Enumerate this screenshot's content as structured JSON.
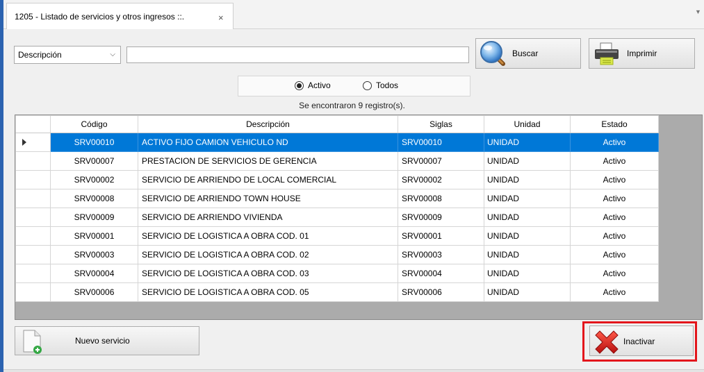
{
  "tab": {
    "title": "1205 - Listado de servicios y otros ingresos ::.",
    "close_glyph": "×",
    "menu_glyph": "▼"
  },
  "filter": {
    "field": "Descripción",
    "search_value": "",
    "chevron_glyph": "⌵"
  },
  "buttons": {
    "search": "Buscar",
    "print": "Imprimir",
    "new_service": "Nuevo servicio",
    "deactivate": "Inactivar"
  },
  "status_filter": {
    "active": "Activo",
    "all": "Todos",
    "selected": "active"
  },
  "result_text": "Se encontraron 9 registro(s).",
  "table": {
    "columns": [
      "Código",
      "Descripción",
      "Siglas",
      "Unidad",
      "Estado"
    ],
    "rows": [
      [
        "SRV00010",
        "ACTIVO FIJO CAMION VEHICULO ND",
        "SRV00010",
        "UNIDAD",
        "Activo"
      ],
      [
        "SRV00007",
        "PRESTACION DE SERVICIOS DE GERENCIA",
        "SRV00007",
        "UNIDAD",
        "Activo"
      ],
      [
        "SRV00002",
        "SERVICIO DE ARRIENDO DE LOCAL COMERCIAL",
        "SRV00002",
        "UNIDAD",
        "Activo"
      ],
      [
        "SRV00008",
        "SERVICIO DE ARRIENDO TOWN HOUSE",
        "SRV00008",
        "UNIDAD",
        "Activo"
      ],
      [
        "SRV00009",
        "SERVICIO DE ARRIENDO VIVIENDA",
        "SRV00009",
        "UNIDAD",
        "Activo"
      ],
      [
        "SRV00001",
        "SERVICIO DE LOGISTICA A OBRA COD. 01",
        "SRV00001",
        "UNIDAD",
        "Activo"
      ],
      [
        "SRV00003",
        "SERVICIO DE LOGISTICA A OBRA COD. 02",
        "SRV00003",
        "UNIDAD",
        "Activo"
      ],
      [
        "SRV00004",
        "SERVICIO DE LOGISTICA A OBRA COD. 03",
        "SRV00004",
        "UNIDAD",
        "Activo"
      ],
      [
        "SRV00006",
        "SERVICIO DE LOGISTICA A OBRA COD. 05",
        "SRV00006",
        "UNIDAD",
        "Activo"
      ]
    ],
    "selected_row": 0
  },
  "icons": {
    "search": "magnifier-icon",
    "print": "printer-icon",
    "new_service": "new-document-icon",
    "deactivate": "red-x-icon"
  },
  "colors": {
    "selection": "#0078d7",
    "highlight": "#e3161c",
    "window_accent": "#2c63b0"
  }
}
